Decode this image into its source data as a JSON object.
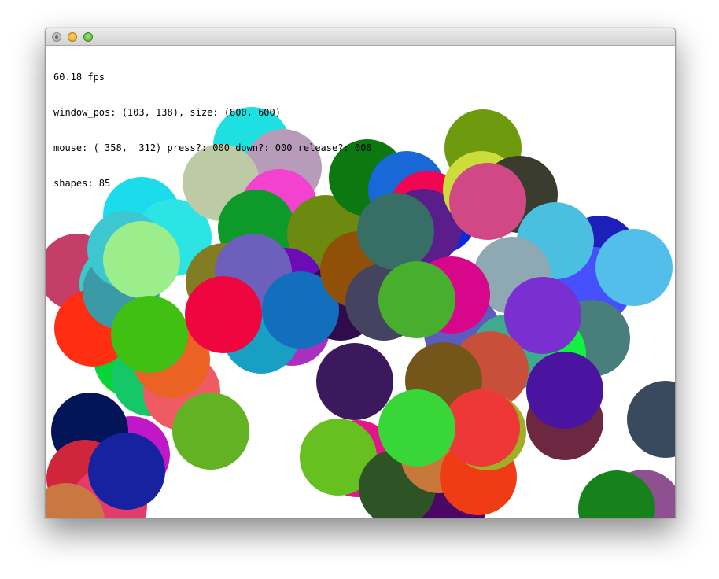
{
  "hud": {
    "fps": "60.18 fps",
    "window_info": "window_pos: (103, 138), size: (800, 600)",
    "mouse_info": "mouse: ( 358,  312) press?: 000 down?: 000 release?: 000",
    "shapes": "shapes: 85"
  },
  "circles": [
    {
      "c": [
        40,
        288
      ],
      "fill": "#c53e6a"
    },
    {
      "c": [
        92,
        303
      ],
      "fill": "#3ec9c9"
    },
    {
      "c": [
        110,
        398
      ],
      "fill": "#07d436"
    },
    {
      "c": [
        60,
        359
      ],
      "fill": "#ff2e12"
    },
    {
      "c": [
        96,
        312
      ],
      "fill": "#3b9aa5"
    },
    {
      "c": [
        122,
        216
      ],
      "fill": "#1cdceb"
    },
    {
      "c": [
        162,
        244
      ],
      "fill": "#2ce4e4"
    },
    {
      "c": [
        102,
        259
      ],
      "fill": "#3cc7d1"
    },
    {
      "c": [
        122,
        272
      ],
      "fill": "#9cee8c"
    },
    {
      "c": [
        262,
        127
      ],
      "fill": "#1ee0e0"
    },
    {
      "c": [
        302,
        155
      ],
      "fill": "#b89bb8"
    },
    {
      "c": [
        223,
        174
      ],
      "fill": "#bccba6"
    },
    {
      "c": [
        297,
        206
      ],
      "fill": "#f442d0"
    },
    {
      "c": [
        268,
        232
      ],
      "fill": "#0d9a28"
    },
    {
      "c": [
        356,
        239
      ],
      "fill": "#6d8a10"
    },
    {
      "c": [
        305,
        306
      ],
      "fill": "#6c0bb8"
    },
    {
      "c": [
        313,
        358
      ],
      "fill": "#aa2fbe"
    },
    {
      "c": [
        274,
        368
      ],
      "fill": "#17a0c3"
    },
    {
      "c": [
        227,
        300
      ],
      "fill": "#827c22"
    },
    {
      "c": [
        264,
        288
      ],
      "fill": "#6d5fbc"
    },
    {
      "c": [
        375,
        326
      ],
      "fill": "#2f0c4c"
    },
    {
      "c": [
        324,
        336
      ],
      "fill": "#136ebd"
    },
    {
      "c": [
        398,
        285
      ],
      "fill": "#915007"
    },
    {
      "c": [
        430,
        326
      ],
      "fill": "#444460"
    },
    {
      "c": [
        409,
        168
      ],
      "fill": "#0c7810"
    },
    {
      "c": [
        459,
        183
      ],
      "fill": "#1868d8"
    },
    {
      "c": [
        500,
        216
      ],
      "fill": "#0e2ad8"
    },
    {
      "c": [
        486,
        208
      ],
      "fill": "#f00652"
    },
    {
      "c": [
        480,
        231
      ],
      "fill": "#5a1e8c"
    },
    {
      "c": [
        445,
        236
      ],
      "fill": "#376e66"
    },
    {
      "c": [
        556,
        130
      ],
      "fill": "#6e9a10"
    },
    {
      "c": [
        554,
        183
      ],
      "fill": "#ccdc3a"
    },
    {
      "c": [
        602,
        189
      ],
      "fill": "#3a3d2d"
    },
    {
      "c": [
        562,
        198
      ],
      "fill": "#d04986"
    },
    {
      "c": [
        704,
        265
      ],
      "fill": "#1c20b8"
    },
    {
      "c": [
        697,
        305
      ],
      "fill": "#4650fc"
    },
    {
      "c": [
        648,
        248
      ],
      "fill": "#4bbfdf"
    },
    {
      "c": [
        748,
        282
      ],
      "fill": "#54beea"
    },
    {
      "c": [
        694,
        372
      ],
      "fill": "#487e7c"
    },
    {
      "c": [
        593,
        292
      ],
      "fill": "#8fa9b2"
    },
    {
      "c": [
        530,
        365
      ],
      "fill": "#5c5cc0"
    },
    {
      "c": [
        516,
        317
      ],
      "fill": "#d8068a"
    },
    {
      "c": [
        472,
        323
      ],
      "fill": "#48ae2e"
    },
    {
      "c": [
        638,
        392
      ],
      "fill": "#12f040"
    },
    {
      "c": [
        590,
        390
      ],
      "fill": "#3faa8c"
    },
    {
      "c": [
        632,
        343
      ],
      "fill": "#7a30d0"
    },
    {
      "c": [
        565,
        412
      ],
      "fill": "#c8503a"
    },
    {
      "c": [
        506,
        426
      ],
      "fill": "#74561a"
    },
    {
      "c": [
        393,
        427
      ],
      "fill": "#3c185c"
    },
    {
      "c": [
        660,
        478
      ],
      "fill": "#6c2840"
    },
    {
      "c": [
        660,
        438
      ],
      "fill": "#4a14a0"
    },
    {
      "c": [
        788,
        475
      ],
      "fill": "#3a4a5e"
    },
    {
      "c": [
        109,
        520
      ],
      "fill": "#c018c8"
    },
    {
      "c": [
        56,
        490
      ],
      "fill": "#031558"
    },
    {
      "c": [
        50,
        550
      ],
      "fill": "#d0263c"
    },
    {
      "c": [
        80,
        585
      ],
      "fill": "#e23c6c"
    },
    {
      "c": [
        26,
        605
      ],
      "fill": "#c87840"
    },
    {
      "c": [
        103,
        541
      ],
      "fill": "#1722a0"
    },
    {
      "c": [
        133,
        422
      ],
      "fill": "#14c86a"
    },
    {
      "c": [
        173,
        440
      ],
      "fill": "#f05a62"
    },
    {
      "c": [
        160,
        399
      ],
      "fill": "#ea6224"
    },
    {
      "c": [
        132,
        367
      ],
      "fill": "#3fc012"
    },
    {
      "c": [
        210,
        490
      ],
      "fill": "#62b224"
    },
    {
      "c": [
        226,
        342
      ],
      "fill": "#f0063e"
    },
    {
      "c": [
        396,
        525
      ],
      "fill": "#e4148a"
    },
    {
      "c": [
        372,
        523
      ],
      "fill": "#66c020"
    },
    {
      "c": [
        512,
        582
      ],
      "fill": "#4a0864"
    },
    {
      "c": [
        447,
        562
      ],
      "fill": "#2e5426"
    },
    {
      "c": [
        500,
        520
      ],
      "fill": "#c8783a"
    },
    {
      "c": [
        550,
        548
      ],
      "fill": "#f03c14"
    },
    {
      "c": [
        562,
        491
      ],
      "fill": "#a0b026"
    },
    {
      "c": [
        554,
        486
      ],
      "fill": "#ee3838"
    },
    {
      "c": [
        472,
        486
      ],
      "fill": "#38d638"
    },
    {
      "c": [
        743,
        603
      ],
      "fill": "#eb18a2"
    },
    {
      "c": [
        760,
        588
      ],
      "fill": "#8e5090"
    },
    {
      "c": [
        726,
        589
      ],
      "fill": "#17821c"
    }
  ]
}
